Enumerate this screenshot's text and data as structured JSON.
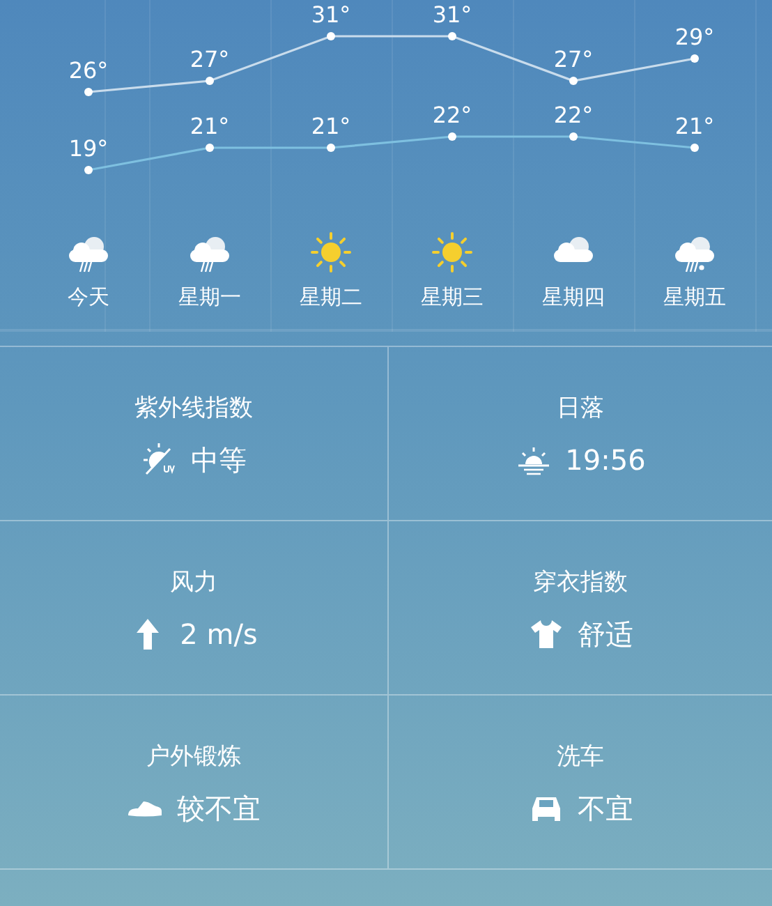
{
  "forecast": {
    "chart_data": {
      "type": "line",
      "categories": [
        "今天",
        "星期一",
        "星期二",
        "星期三",
        "星期四",
        "星期五"
      ],
      "data_labels": true,
      "series": [
        {
          "color": "#c9dcec",
          "marker": true,
          "values": [
            26,
            27,
            31,
            31,
            27,
            29
          ],
          "value_labels": [
            "26°",
            "27°",
            "31°",
            "31°",
            "27°",
            "29°"
          ]
        },
        {
          "color": "#7ec0e0",
          "marker": true,
          "values": [
            19,
            21,
            21,
            22,
            22,
            21
          ],
          "value_labels": [
            "19°",
            "21°",
            "21°",
            "22°",
            "22°",
            "21°"
          ]
        }
      ]
    },
    "days": [
      {
        "kind": "rain"
      },
      {
        "kind": "rain"
      },
      {
        "kind": "sun"
      },
      {
        "kind": "sun"
      },
      {
        "kind": "cloud"
      },
      {
        "kind": "showers"
      }
    ]
  },
  "details": [
    {
      "title": "紫外线指数",
      "kind": "uv",
      "value": "中等"
    },
    {
      "title": "日落",
      "kind": "sunset",
      "value": "19:56"
    },
    {
      "title": "风力",
      "kind": "arrow",
      "value": "2 m/s"
    },
    {
      "title": "穿衣指数",
      "kind": "shirt",
      "value": "舒适"
    },
    {
      "title": "户外锻炼",
      "kind": "shoe",
      "value": "较不宜"
    },
    {
      "title": "洗车",
      "kind": "car",
      "value": "不宜"
    }
  ]
}
